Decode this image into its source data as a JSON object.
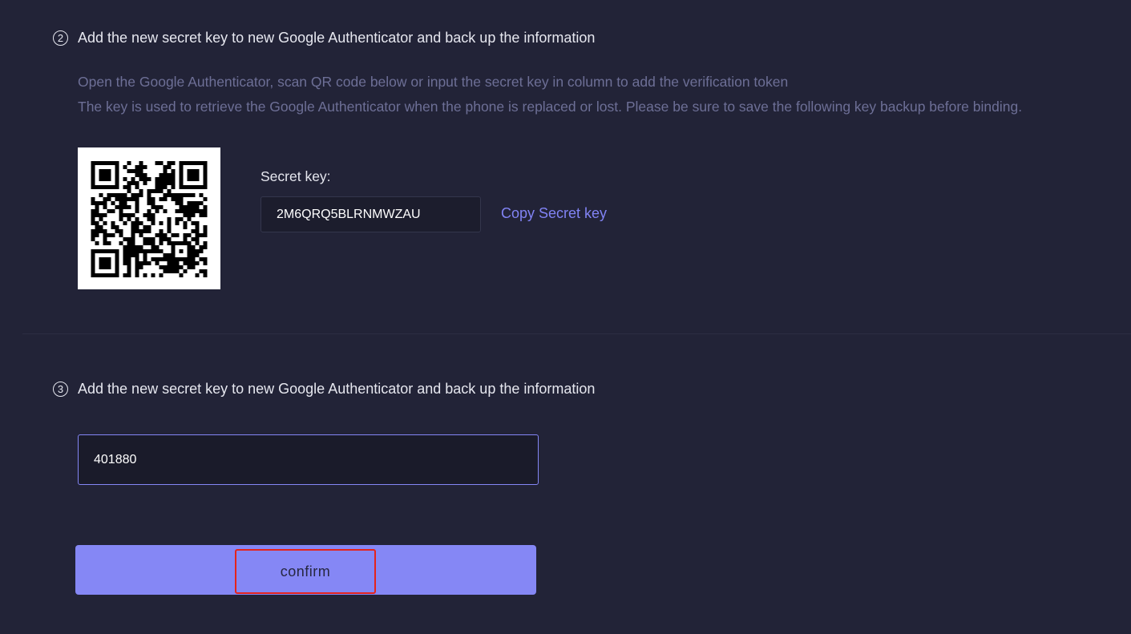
{
  "step2": {
    "number": "2",
    "title": "Add the new secret key to new Google Authenticator and back up the information",
    "description_line1": "Open the Google Authenticator, scan QR code below or input the secret key in column to add the verification token",
    "description_line2": "The key is used to retrieve the Google Authenticator when the phone is replaced or lost. Please be sure to save the following key backup before binding.",
    "secret_key_label": "Secret key:",
    "secret_key_value": "2M6QRQ5BLRNMWZAU",
    "copy_link": "Copy Secret key"
  },
  "step3": {
    "number": "3",
    "title": "Add the new secret key to new Google Authenticator and back up the information",
    "code_value": "401880"
  },
  "confirm_button": "confirm",
  "colors": {
    "background": "#222337",
    "accent": "#8587f5",
    "link": "#8183f4",
    "highlight": "#e5231b"
  }
}
